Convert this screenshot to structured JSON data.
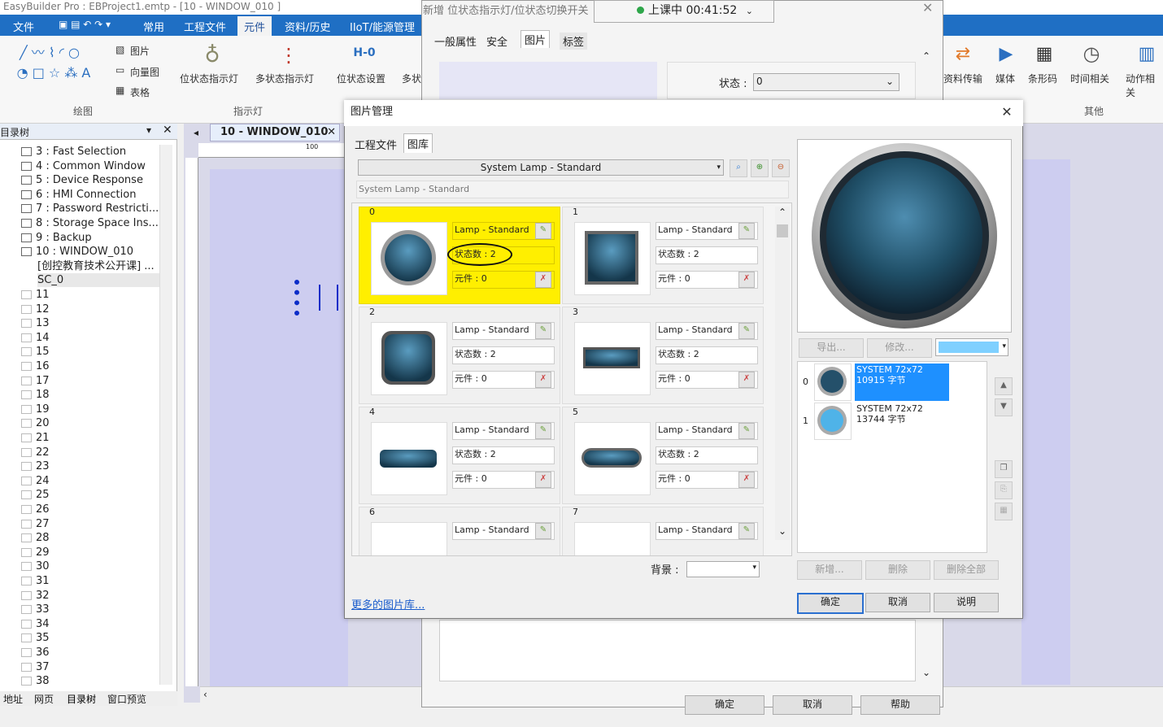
{
  "window": {
    "title": "EasyBuilder Pro : EBProject1.emtp - [10 - WINDOW_010 ]"
  },
  "menu": {
    "file": "文件",
    "common": "常用",
    "project_file": "工程文件",
    "component": "元件",
    "data_history": "资料/历史",
    "iiot": "IIoT/能源管理"
  },
  "ribbon": {
    "picture": "图片",
    "vector": "向量图",
    "table": "表格",
    "drawing_group": "绘图",
    "bit_lamp": "位状态指示灯",
    "multi_lamp": "多状态指示灯",
    "lamp_group": "指示灯",
    "bit_set": "位状态设置",
    "multi_set_partial": "多状",
    "data_transfer": "资料传输",
    "media": "媒体",
    "barcode": "条形码",
    "time": "时间相关",
    "action": "动作相关",
    "other_group": "其他"
  },
  "tree": {
    "header": "目录树",
    "items": [
      "3 : Fast Selection",
      "4 : Common Window",
      "5 : Device Response",
      "6 : HMI Connection",
      "7 : Password Restricti...",
      "8 : Storage Space Ins...",
      "9 : Backup",
      "10 : WINDOW_010"
    ],
    "subitems": [
      "[创控教育技术公开课] ...",
      "SC_0"
    ],
    "numbers": [
      "11",
      "12",
      "13",
      "14",
      "15",
      "16",
      "17",
      "18",
      "19",
      "20",
      "21",
      "22",
      "23",
      "24",
      "25",
      "26",
      "27",
      "28",
      "29",
      "30",
      "31",
      "32",
      "33",
      "34",
      "35",
      "36",
      "37",
      "38"
    ],
    "bottom_tabs": [
      "地址",
      "网页",
      "目录树",
      "窗口预览"
    ]
  },
  "doc_tab": "10 - WINDOW_010",
  "ruler_label": "100",
  "bg_dialog": {
    "title": "新增 位状态指示灯/位状态切换开关",
    "tabs": [
      "一般属性",
      "安全",
      "图片",
      "标签"
    ],
    "state_label": "状态 :",
    "state_value": "0",
    "bottom_buttons": [
      "确定",
      "取消",
      "帮助"
    ]
  },
  "timer": {
    "text": "上课中 00:41:52"
  },
  "dialog": {
    "title": "图片管理",
    "tabs": [
      "工程文件",
      "图库"
    ],
    "library": "System Lamp - Standard",
    "subtitle": "System Lamp - Standard",
    "cells": [
      {
        "index": "0",
        "name": "Lamp - Standard",
        "states": "状态数 : 2",
        "component": "元件 : 0",
        "shape": "circle",
        "selected": true
      },
      {
        "index": "1",
        "name": "Lamp - Standard",
        "states": "状态数 : 2",
        "component": "元件 : 0",
        "shape": "square"
      },
      {
        "index": "2",
        "name": "Lamp - Standard",
        "states": "状态数 : 2",
        "component": "元件 : 0",
        "shape": "rounded"
      },
      {
        "index": "3",
        "name": "Lamp - Standard",
        "states": "状态数 : 2",
        "component": "元件 : 0",
        "shape": "wide"
      },
      {
        "index": "4",
        "name": "Lamp - Standard",
        "states": "状态数 : 2",
        "component": "元件 : 0",
        "shape": "bar"
      },
      {
        "index": "5",
        "name": "Lamp - Standard",
        "states": "状态数 : 2",
        "component": "元件 : 0",
        "shape": "pill"
      },
      {
        "index": "6",
        "name": "Lamp - Standard",
        "states": "",
        "component": "",
        "shape": "none"
      },
      {
        "index": "7",
        "name": "Lamp - Standard",
        "states": "",
        "component": "",
        "shape": "none"
      }
    ],
    "background_label": "背景 :",
    "export_btn": "导出...",
    "modify_btn": "修改...",
    "state_list": [
      {
        "index": "0",
        "name": "SYSTEM 72x72",
        "size": "10915 字节",
        "color": "#24506a"
      },
      {
        "index": "1",
        "name": "SYSTEM 72x72",
        "size": "13744 字节",
        "color": "#4fb3e8"
      }
    ],
    "add_btn": "新增...",
    "delete_btn": "删除",
    "delete_all_btn": "删除全部",
    "more_link": "更多的图片库...",
    "ok_btn": "确定",
    "cancel_btn": "取消",
    "help_btn": "说明"
  },
  "colors": {
    "accent": "#1f6fc4",
    "selection": "#ffef00",
    "list_selection": "#1e90ff"
  }
}
